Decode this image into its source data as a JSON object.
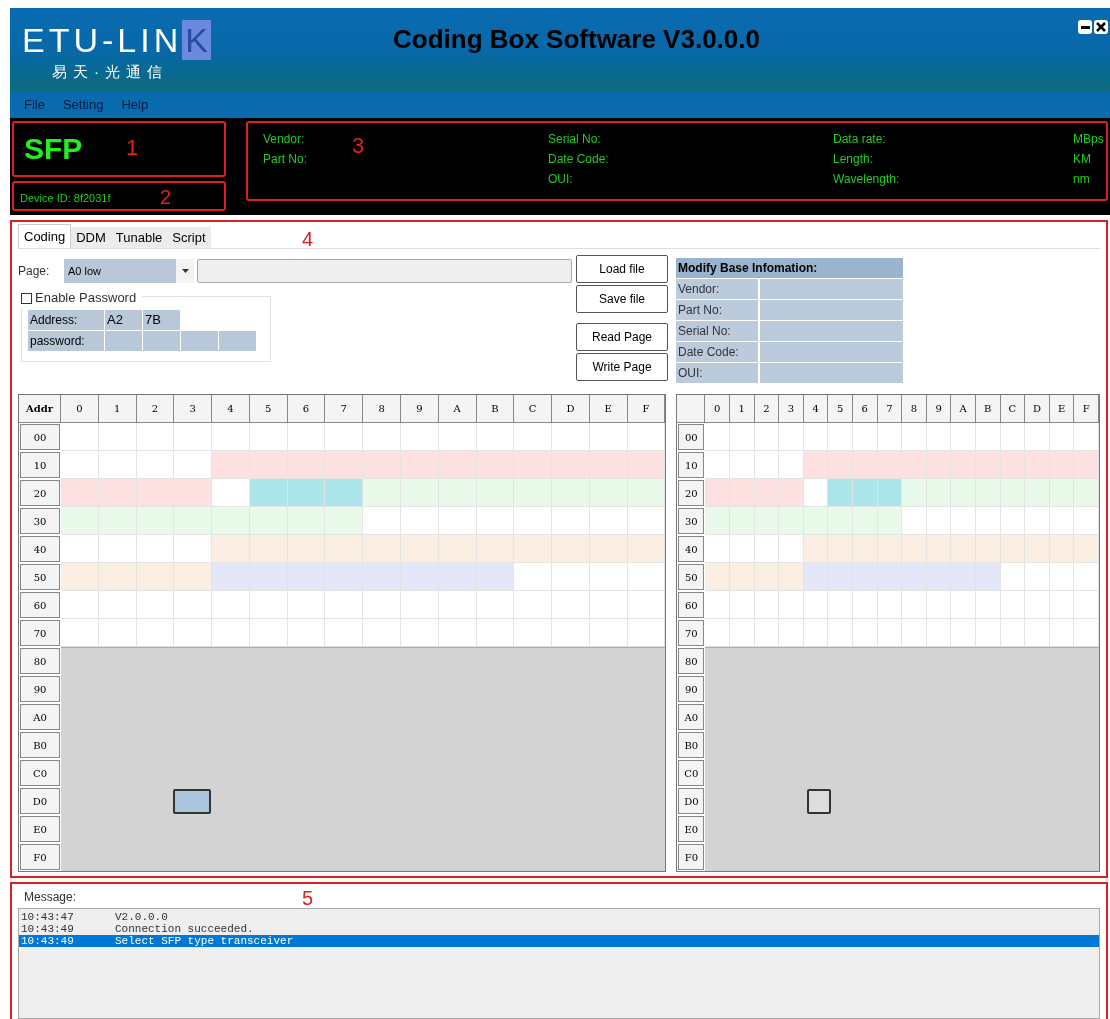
{
  "window": {
    "logo_text": "ETU-LIN",
    "logo_letter": "K",
    "logo_subtitle": "易天·光通信",
    "title": "Coding Box Software V3.0.0.0"
  },
  "menu": [
    "File",
    "Setting",
    "Help"
  ],
  "module": {
    "type": "SFP",
    "annotation": "1"
  },
  "device": {
    "text": "Device ID: 8f2031f",
    "annotation": "2"
  },
  "info": {
    "annotation": "3",
    "columns": [
      [
        "Vendor:",
        "Part No:"
      ],
      [
        "Serial No:",
        "Date Code:",
        "OUI:"
      ],
      [
        "Data rate:",
        "Length:",
        "Wavelength:"
      ],
      [
        "MBps",
        "KM",
        "nm"
      ]
    ]
  },
  "main": {
    "annotation": "4",
    "tabs": [
      {
        "label": "Coding",
        "selected": true
      },
      {
        "label": "DDM",
        "selected": false
      },
      {
        "label": "Tunable",
        "selected": false
      },
      {
        "label": "Script",
        "selected": false
      }
    ],
    "page": {
      "label": "Page:",
      "value": "A0 low"
    },
    "buttons": [
      "Load file",
      "Save file",
      "Read Page",
      "Write Page"
    ],
    "password": {
      "label": "Enable Password",
      "checked": false,
      "address_label": "Address:",
      "address": [
        "A2",
        "7B"
      ],
      "password_label": "password:"
    },
    "base_info": {
      "title": "Modify Base Infomation:",
      "rows": [
        "Vendor:",
        "Part No:",
        "Serial No:",
        "Date Code:",
        "OUI:"
      ]
    },
    "grids": [
      {
        "corner": "Addr",
        "columns": [
          "0",
          "1",
          "2",
          "3",
          "4",
          "5",
          "6",
          "7",
          "8",
          "9",
          "A",
          "B",
          "C",
          "D",
          "E",
          "F"
        ],
        "rows": [
          {
            "label": "00",
            "disabled": false,
            "cells": [
              {
                "color": "#ffffff"
              },
              {
                "color": "#ffffff"
              },
              {
                "color": "#ffffff"
              },
              {
                "color": "#ffffff"
              },
              {
                "color": "#ffffff"
              },
              {
                "color": "#ffffff"
              },
              {
                "color": "#ffffff"
              },
              {
                "color": "#ffffff"
              },
              {
                "color": "#ffffff"
              },
              {
                "color": "#ffffff"
              },
              {
                "color": "#ffffff"
              },
              {
                "color": "#ffffff"
              },
              {
                "color": "#ffffff"
              },
              {
                "color": "#ffffff"
              },
              {
                "color": "#ffffff"
              },
              {
                "color": "#ffffff"
              }
            ]
          },
          {
            "label": "10",
            "disabled": false,
            "cells": [
              {
                "color": "#ffffff"
              },
              {
                "color": "#ffffff"
              },
              {
                "color": "#ffffff"
              },
              {
                "color": "#ffffff"
              },
              {
                "color": "#fde0e0"
              },
              {
                "color": "#fde0e0"
              },
              {
                "color": "#fde0e0"
              },
              {
                "color": "#fde0e0"
              },
              {
                "color": "#fde0e0"
              },
              {
                "color": "#fde0e0"
              },
              {
                "color": "#fde0e0"
              },
              {
                "color": "#fde0e0"
              },
              {
                "color": "#fde0e0"
              },
              {
                "color": "#fde0e0"
              },
              {
                "color": "#fde0e0"
              },
              {
                "color": "#fde0e0"
              }
            ]
          },
          {
            "label": "20",
            "disabled": false,
            "cells": [
              {
                "color": "#fde0e0"
              },
              {
                "color": "#fde0e0"
              },
              {
                "color": "#fde0e0"
              },
              {
                "color": "#fde0e0"
              },
              {
                "color": "#ffffff"
              },
              {
                "color": "#abe5ea"
              },
              {
                "color": "#abe5ea"
              },
              {
                "color": "#abe5ea"
              },
              {
                "color": "#e9f9ea"
              },
              {
                "color": "#e9f9ea"
              },
              {
                "color": "#e9f9ea"
              },
              {
                "color": "#e9f9ea"
              },
              {
                "color": "#e9f9ea"
              },
              {
                "color": "#e9f9ea"
              },
              {
                "color": "#e9f9ea"
              },
              {
                "color": "#e9f9ea"
              }
            ]
          },
          {
            "label": "30",
            "disabled": false,
            "cells": [
              {
                "color": "#e9f9ea"
              },
              {
                "color": "#e9f9ea"
              },
              {
                "color": "#e9f9ea"
              },
              {
                "color": "#e9f9ea"
              },
              {
                "color": "#e9f9ea"
              },
              {
                "color": "#e9f9ea"
              },
              {
                "color": "#e9f9ea"
              },
              {
                "color": "#e9f9ea"
              },
              {
                "color": "#ffffff"
              },
              {
                "color": "#ffffff"
              },
              {
                "color": "#ffffff"
              },
              {
                "color": "#ffffff"
              },
              {
                "color": "#ffffff"
              },
              {
                "color": "#ffffff"
              },
              {
                "color": "#ffffff"
              },
              {
                "color": "#ffffff"
              }
            ]
          },
          {
            "label": "40",
            "disabled": false,
            "cells": [
              {
                "color": "#ffffff"
              },
              {
                "color": "#ffffff"
              },
              {
                "color": "#ffffff"
              },
              {
                "color": "#ffffff"
              },
              {
                "color": "#fbeee3"
              },
              {
                "color": "#fbeee3"
              },
              {
                "color": "#fbeee3"
              },
              {
                "color": "#fbeee3"
              },
              {
                "color": "#fbeee3"
              },
              {
                "color": "#fbeee3"
              },
              {
                "color": "#fbeee3"
              },
              {
                "color": "#fbeee3"
              },
              {
                "color": "#fbeee3"
              },
              {
                "color": "#fbeee3"
              },
              {
                "color": "#fbeee3"
              },
              {
                "color": "#fbeee3"
              }
            ]
          },
          {
            "label": "50",
            "disabled": false,
            "cells": [
              {
                "color": "#fbeee3"
              },
              {
                "color": "#fbeee3"
              },
              {
                "color": "#fbeee3"
              },
              {
                "color": "#fbeee3"
              },
              {
                "color": "#e4e6f9"
              },
              {
                "color": "#e4e6f9"
              },
              {
                "color": "#e4e6f9"
              },
              {
                "color": "#e4e6f9"
              },
              {
                "color": "#e4e6f9"
              },
              {
                "color": "#e4e6f9"
              },
              {
                "color": "#e4e6f9"
              },
              {
                "color": "#e4e6f9"
              },
              {
                "color": "#ffffff"
              },
              {
                "color": "#ffffff"
              },
              {
                "color": "#ffffff"
              },
              {
                "color": "#ffffff"
              }
            ]
          },
          {
            "label": "60",
            "disabled": false,
            "cells": [
              {
                "color": "#ffffff"
              },
              {
                "color": "#ffffff"
              },
              {
                "color": "#ffffff"
              },
              {
                "color": "#ffffff"
              },
              {
                "color": "#ffffff"
              },
              {
                "color": "#ffffff"
              },
              {
                "color": "#ffffff"
              },
              {
                "color": "#ffffff"
              },
              {
                "color": "#ffffff"
              },
              {
                "color": "#ffffff"
              },
              {
                "color": "#ffffff"
              },
              {
                "color": "#ffffff"
              },
              {
                "color": "#ffffff"
              },
              {
                "color": "#ffffff"
              },
              {
                "color": "#ffffff"
              },
              {
                "color": "#ffffff"
              }
            ]
          },
          {
            "label": "70",
            "disabled": false,
            "cells": [
              {
                "color": "#ffffff"
              },
              {
                "color": "#ffffff"
              },
              {
                "color": "#ffffff"
              },
              {
                "color": "#ffffff"
              },
              {
                "color": "#ffffff"
              },
              {
                "color": "#ffffff"
              },
              {
                "color": "#ffffff"
              },
              {
                "color": "#ffffff"
              },
              {
                "color": "#ffffff"
              },
              {
                "color": "#ffffff"
              },
              {
                "color": "#ffffff"
              },
              {
                "color": "#ffffff"
              },
              {
                "color": "#ffffff"
              },
              {
                "color": "#ffffff"
              },
              {
                "color": "#ffffff"
              },
              {
                "color": "#ffffff"
              }
            ]
          },
          {
            "label": "80",
            "disabled": true
          },
          {
            "label": "90",
            "disabled": true
          },
          {
            "label": "A0",
            "disabled": true
          },
          {
            "label": "B0",
            "disabled": true
          },
          {
            "label": "C0",
            "disabled": true
          },
          {
            "label": "D0",
            "disabled": true
          },
          {
            "label": "E0",
            "disabled": true
          },
          {
            "label": "F0",
            "disabled": true
          }
        ]
      },
      {
        "columns": [
          "0",
          "1",
          "2",
          "3",
          "4",
          "5",
          "6",
          "7",
          "8",
          "9",
          "A",
          "B",
          "C",
          "D",
          "E",
          "F"
        ],
        "rows": [
          {
            "label": "00",
            "disabled": false,
            "cells": [
              {
                "color": "#ffffff"
              },
              {
                "color": "#ffffff"
              },
              {
                "color": "#ffffff"
              },
              {
                "color": "#ffffff"
              },
              {
                "color": "#ffffff"
              },
              {
                "color": "#ffffff"
              },
              {
                "color": "#ffffff"
              },
              {
                "color": "#ffffff"
              },
              {
                "color": "#ffffff"
              },
              {
                "color": "#ffffff"
              },
              {
                "color": "#ffffff"
              },
              {
                "color": "#ffffff"
              },
              {
                "color": "#ffffff"
              },
              {
                "color": "#ffffff"
              },
              {
                "color": "#ffffff"
              },
              {
                "color": "#ffffff"
              }
            ]
          },
          {
            "label": "10",
            "disabled": false,
            "cells": [
              {
                "color": "#ffffff"
              },
              {
                "color": "#ffffff"
              },
              {
                "color": "#ffffff"
              },
              {
                "color": "#ffffff"
              },
              {
                "color": "#fde0e0"
              },
              {
                "color": "#fde0e0"
              },
              {
                "color": "#fde0e0"
              },
              {
                "color": "#fde0e0"
              },
              {
                "color": "#fde0e0"
              },
              {
                "color": "#fde0e0"
              },
              {
                "color": "#fde0e0"
              },
              {
                "color": "#fde0e0"
              },
              {
                "color": "#fde0e0"
              },
              {
                "color": "#fde0e0"
              },
              {
                "color": "#fde0e0"
              },
              {
                "color": "#fde0e0"
              }
            ]
          },
          {
            "label": "20",
            "disabled": false,
            "cells": [
              {
                "color": "#fde0e0"
              },
              {
                "color": "#fde0e0"
              },
              {
                "color": "#fde0e0"
              },
              {
                "color": "#fde0e0"
              },
              {
                "color": "#ffffff"
              },
              {
                "color": "#abe5ea"
              },
              {
                "color": "#abe5ea"
              },
              {
                "color": "#abe5ea"
              },
              {
                "color": "#e9f9ea"
              },
              {
                "color": "#e9f9ea"
              },
              {
                "color": "#e9f9ea"
              },
              {
                "color": "#e9f9ea"
              },
              {
                "color": "#e9f9ea"
              },
              {
                "color": "#e9f9ea"
              },
              {
                "color": "#e9f9ea"
              },
              {
                "color": "#e9f9ea"
              }
            ]
          },
          {
            "label": "30",
            "disabled": false,
            "cells": [
              {
                "color": "#e9f9ea"
              },
              {
                "color": "#e9f9ea"
              },
              {
                "color": "#e9f9ea"
              },
              {
                "color": "#e9f9ea"
              },
              {
                "color": "#e9f9ea"
              },
              {
                "color": "#e9f9ea"
              },
              {
                "color": "#e9f9ea"
              },
              {
                "color": "#e9f9ea"
              },
              {
                "color": "#ffffff"
              },
              {
                "color": "#ffffff"
              },
              {
                "color": "#ffffff"
              },
              {
                "color": "#ffffff"
              },
              {
                "color": "#ffffff"
              },
              {
                "color": "#ffffff"
              },
              {
                "color": "#ffffff"
              },
              {
                "color": "#ffffff"
              }
            ]
          },
          {
            "label": "40",
            "disabled": false,
            "cells": [
              {
                "color": "#ffffff"
              },
              {
                "color": "#ffffff"
              },
              {
                "color": "#ffffff"
              },
              {
                "color": "#ffffff"
              },
              {
                "color": "#fbeee3"
              },
              {
                "color": "#fbeee3"
              },
              {
                "color": "#fbeee3"
              },
              {
                "color": "#fbeee3"
              },
              {
                "color": "#fbeee3"
              },
              {
                "color": "#fbeee3"
              },
              {
                "color": "#fbeee3"
              },
              {
                "color": "#fbeee3"
              },
              {
                "color": "#fbeee3"
              },
              {
                "color": "#fbeee3"
              },
              {
                "color": "#fbeee3"
              },
              {
                "color": "#fbeee3"
              }
            ]
          },
          {
            "label": "50",
            "disabled": false,
            "cells": [
              {
                "color": "#fbeee3"
              },
              {
                "color": "#fbeee3"
              },
              {
                "color": "#fbeee3"
              },
              {
                "color": "#fbeee3"
              },
              {
                "color": "#e4e6f9"
              },
              {
                "color": "#e4e6f9"
              },
              {
                "color": "#e4e6f9"
              },
              {
                "color": "#e4e6f9"
              },
              {
                "color": "#e4e6f9"
              },
              {
                "color": "#e4e6f9"
              },
              {
                "color": "#e4e6f9"
              },
              {
                "color": "#e4e6f9"
              },
              {
                "color": "#ffffff"
              },
              {
                "color": "#ffffff"
              },
              {
                "color": "#ffffff"
              },
              {
                "color": "#ffffff"
              }
            ]
          },
          {
            "label": "60",
            "disabled": false,
            "cells": [
              {
                "color": "#ffffff"
              },
              {
                "color": "#ffffff"
              },
              {
                "color": "#ffffff"
              },
              {
                "color": "#ffffff"
              },
              {
                "color": "#ffffff"
              },
              {
                "color": "#ffffff"
              },
              {
                "color": "#ffffff"
              },
              {
                "color": "#ffffff"
              },
              {
                "color": "#ffffff"
              },
              {
                "color": "#ffffff"
              },
              {
                "color": "#ffffff"
              },
              {
                "color": "#ffffff"
              },
              {
                "color": "#ffffff"
              },
              {
                "color": "#ffffff"
              },
              {
                "color": "#ffffff"
              },
              {
                "color": "#ffffff"
              }
            ]
          },
          {
            "label": "70",
            "disabled": false,
            "cells": [
              {
                "color": "#ffffff"
              },
              {
                "color": "#ffffff"
              },
              {
                "color": "#ffffff"
              },
              {
                "color": "#ffffff"
              },
              {
                "color": "#ffffff"
              },
              {
                "color": "#ffffff"
              },
              {
                "color": "#ffffff"
              },
              {
                "color": "#ffffff"
              },
              {
                "color": "#ffffff"
              },
              {
                "color": "#ffffff"
              },
              {
                "color": "#ffffff"
              },
              {
                "color": "#ffffff"
              },
              {
                "color": "#ffffff"
              },
              {
                "color": "#ffffff"
              },
              {
                "color": "#ffffff"
              },
              {
                "color": "#ffffff"
              }
            ]
          },
          {
            "label": "80",
            "disabled": true
          },
          {
            "label": "90",
            "disabled": true
          },
          {
            "label": "A0",
            "disabled": true
          },
          {
            "label": "B0",
            "disabled": true
          },
          {
            "label": "C0",
            "disabled": true
          },
          {
            "label": "D0",
            "disabled": true
          },
          {
            "label": "E0",
            "disabled": true
          },
          {
            "label": "F0",
            "disabled": true
          }
        ]
      }
    ]
  },
  "messages": {
    "annotation": "5",
    "label": "Message:",
    "lines": [
      {
        "time": "10:43:47",
        "text": "V2.0.0.0",
        "selected": false
      },
      {
        "time": "10:43:49",
        "text": "Connection succeeded.",
        "selected": false
      },
      {
        "time": "10:43:49",
        "text": "Select SFP type transceiver",
        "selected": true
      }
    ]
  }
}
